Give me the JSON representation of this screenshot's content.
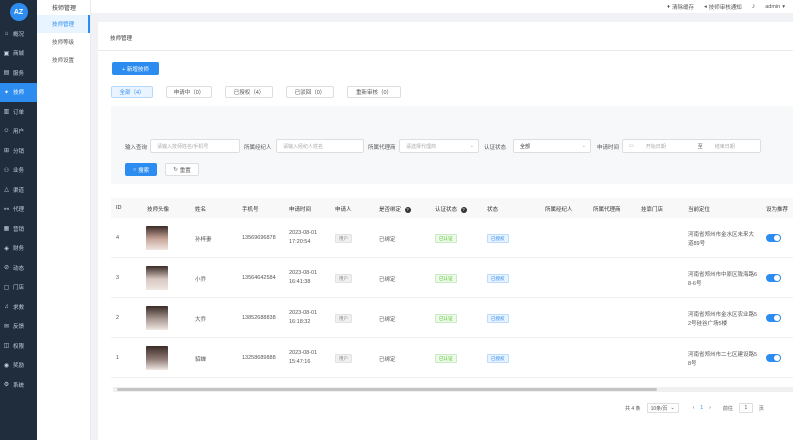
{
  "nav": {
    "logo": "AZ",
    "items": [
      {
        "icon": "home-icon",
        "glyph": "⌂",
        "label": "概况"
      },
      {
        "icon": "shop-icon",
        "glyph": "▣",
        "label": "商城"
      },
      {
        "icon": "service-icon",
        "glyph": "▤",
        "label": "服务"
      },
      {
        "icon": "technician-icon",
        "glyph": "✦",
        "label": "技师",
        "active": true
      },
      {
        "icon": "order-icon",
        "glyph": "▥",
        "label": "订单"
      },
      {
        "icon": "user-icon",
        "glyph": "☺",
        "label": "用户"
      },
      {
        "icon": "distribution-icon",
        "glyph": "⊞",
        "label": "分销"
      },
      {
        "icon": "business-icon",
        "glyph": "⚇",
        "label": "业务"
      },
      {
        "icon": "channel-icon",
        "glyph": "△",
        "label": "渠道"
      },
      {
        "icon": "agent-icon",
        "glyph": "⚯",
        "label": "代理"
      },
      {
        "icon": "marketing-icon",
        "glyph": "▦",
        "label": "营销"
      },
      {
        "icon": "finance-icon",
        "glyph": "◈",
        "label": "财务"
      },
      {
        "icon": "news-icon",
        "glyph": "⊘",
        "label": "动态"
      },
      {
        "icon": "store-icon",
        "glyph": "▢",
        "label": "门店"
      },
      {
        "icon": "help-icon",
        "glyph": "♫",
        "label": "求救"
      },
      {
        "icon": "feedback-icon",
        "glyph": "✉",
        "label": "反馈"
      },
      {
        "icon": "permission-icon",
        "glyph": "◫",
        "label": "权限"
      },
      {
        "icon": "award-icon",
        "glyph": "◉",
        "label": "奖励"
      },
      {
        "icon": "system-icon",
        "glyph": "⚙",
        "label": "系统"
      }
    ]
  },
  "submenu": {
    "title": "技师管理",
    "items": [
      {
        "label": "技师管理",
        "active": true
      },
      {
        "label": "技师等级"
      },
      {
        "label": "技师设置"
      }
    ]
  },
  "topbar": {
    "clear_cache": "清除缓存",
    "tech_notice": "技师审核通知",
    "username": "admin"
  },
  "page": {
    "title": "技师管理",
    "add_button": "+ 新增技师"
  },
  "tabs": [
    {
      "label": "全部（4）",
      "active": true
    },
    {
      "label": "申请中（0）"
    },
    {
      "label": "已授权（4）"
    },
    {
      "label": "已驳回（0）"
    },
    {
      "label": "重新审核（0）"
    }
  ],
  "filter": {
    "keyword_label": "输入查询",
    "keyword_placeholder": "请输入技师姓名/手机号",
    "manager_label": "所属经纪人",
    "manager_placeholder": "请输入经纪人姓名",
    "agent_label": "所属代理商",
    "agent_placeholder": "请选择代理商",
    "status_label": "认证状态",
    "status_value": "全部",
    "date_label": "申请时间",
    "date_start": "开始日期",
    "date_sep": "至",
    "date_end": "结束日期",
    "search_button": "搜索",
    "reset_button": "重置"
  },
  "table": {
    "headers": [
      "ID",
      "技师头像",
      "姓名",
      "手机号",
      "申请时间",
      "申请人",
      "是否绑定",
      "认证状态",
      "状态",
      "所属经纪人",
      "所属代理商",
      "挂靠门店",
      "当前定位",
      "设为推荐"
    ],
    "rows": [
      {
        "id": "4",
        "name": "孙梓妻",
        "phone": "13569696878",
        "date": "2023-08-01",
        "time": "17:20:54",
        "applicant": "用户",
        "bound": "已绑定",
        "cert": "已认证",
        "status": "已授权",
        "loc1": "河南省郑州市金水区未来大",
        "loc2": "道89号"
      },
      {
        "id": "3",
        "name": "小乔",
        "phone": "13564642584",
        "date": "2023-08-01",
        "time": "16:41:38",
        "applicant": "用户",
        "bound": "已绑定",
        "cert": "已认证",
        "status": "已授权",
        "loc1": "河南省郑州市中原区陇海路6",
        "loc2": "8-6号"
      },
      {
        "id": "2",
        "name": "大乔",
        "phone": "13852688838",
        "date": "2023-08-01",
        "time": "16:18:32",
        "applicant": "用户",
        "bound": "已绑定",
        "cert": "已认证",
        "status": "已授权",
        "loc1": "河南省郑州市金水区农业路5",
        "loc2": "2号硅谷广场5楼"
      },
      {
        "id": "1",
        "name": "貂蝉",
        "phone": "13258689888",
        "date": "2023-08-01",
        "time": "15:47:16",
        "applicant": "用户",
        "bound": "已绑定",
        "cert": "已认证",
        "status": "已授权",
        "loc1": "河南省郑州市二七区建设路5",
        "loc2": "8号"
      }
    ]
  },
  "pagination": {
    "total": "共 4 条",
    "page_size": "10条/页",
    "prev": "‹",
    "current": "1",
    "next": "›",
    "goto_label": "前往",
    "goto_value": "1",
    "page_suffix": "页"
  },
  "colors": {
    "primary": "#2d8cf0",
    "sidebar": "#1f2d3d"
  }
}
